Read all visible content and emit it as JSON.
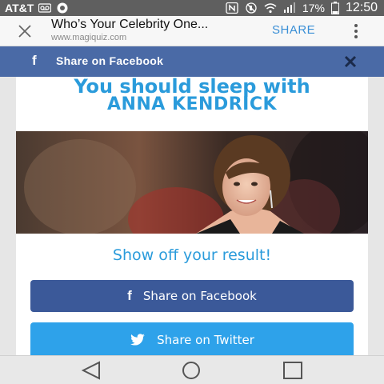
{
  "status_bar": {
    "carrier": "AT&T",
    "battery_percent": "17%",
    "time": "12:50",
    "icons": [
      "voicemail-icon",
      "app-icon",
      "nfc-icon",
      "mute-icon",
      "wifi-icon",
      "signal-icon",
      "battery-icon"
    ]
  },
  "browser": {
    "page_title": "Who’s Your Celebrity One...",
    "url": "www.magiquiz.com",
    "share_label": "SHARE"
  },
  "sticky_bar": {
    "label": "Share on Facebook",
    "brand_color": "#4a6aa6"
  },
  "result": {
    "line1": "You should sleep with",
    "line2": "ANNA KENDRICK"
  },
  "show_off_text": "Show off your result!",
  "buttons": {
    "facebook_label": "Share on Facebook",
    "twitter_label": "Share on Twitter",
    "facebook_color": "#3b5999",
    "twitter_color": "#2ea2ea"
  },
  "accent_color": "#2a9bdb"
}
